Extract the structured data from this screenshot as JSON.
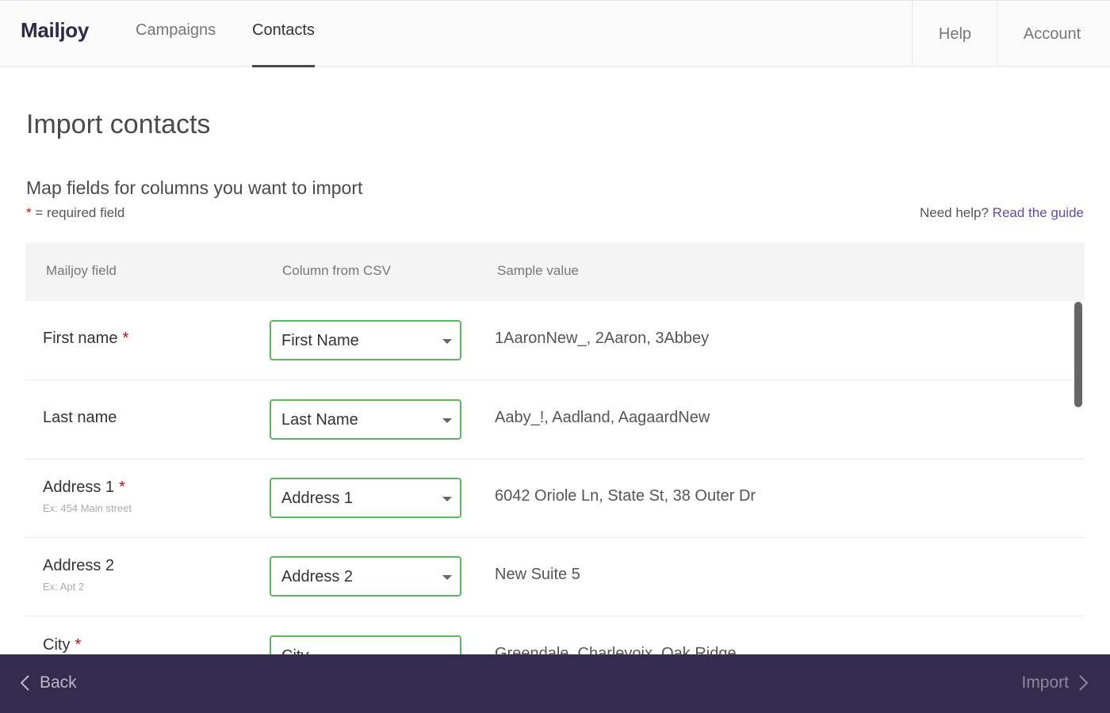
{
  "app": {
    "brand": "Mailjoy",
    "nav": {
      "campaigns": "Campaigns",
      "contacts": "Contacts",
      "help": "Help",
      "account": "Account"
    }
  },
  "page": {
    "title": "Import contacts",
    "section_title": "Map fields for columns you want to import",
    "required_star": "*",
    "required_text": " = required field",
    "help_prefix": "Need help?",
    "help_link": "Read the guide"
  },
  "table": {
    "headers": {
      "field": "Mailjoy field",
      "column": "Column from CSV",
      "sample": "Sample value"
    },
    "rows": [
      {
        "label": "First name",
        "required": "*",
        "hint": "",
        "selected": "First Name",
        "sample": "1AaronNew_, 2Aaron, 3Abbey"
      },
      {
        "label": "Last name",
        "required": "",
        "hint": "",
        "selected": "Last Name",
        "sample": "Aaby_!, Aadland, AagaardNew"
      },
      {
        "label": "Address 1",
        "required": "*",
        "hint": "Ex: 454 Main street",
        "selected": "Address 1",
        "sample": "6042 Oriole Ln, State St, 38 Outer Dr"
      },
      {
        "label": "Address 2",
        "required": "",
        "hint": "Ex: Apt 2",
        "selected": "Address 2",
        "sample": "New Suite 5"
      },
      {
        "label": "City",
        "required": "*",
        "hint": "",
        "selected": "City",
        "sample": "Greendale, Charlevoix, Oak Ridge"
      }
    ]
  },
  "footer": {
    "back": "Back",
    "import": "Import"
  },
  "colors": {
    "accent_purple": "#342b4e",
    "link": "#5a4fa3",
    "valid_green": "#5cb85c",
    "required_red": "#d0021b"
  }
}
